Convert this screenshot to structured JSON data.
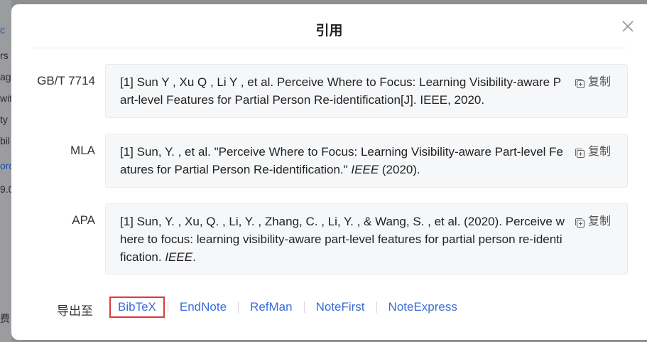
{
  "background_fragments": [
    "c",
    "rs",
    "ag",
    "wit",
    "ty",
    "bil",
    "ord",
    "9.0",
    "费"
  ],
  "dialog": {
    "title": "引用",
    "copy_label": "复制",
    "citations": [
      {
        "format": "GB/T 7714",
        "text": "[1] Sun Y , Xu Q , Li Y , et al. Perceive Where to Focus: Learning Visibility-aware Part-level Features for Partial Person Re-identification[J]. IEEE, 2020."
      },
      {
        "format": "MLA",
        "text_before": "[1] Sun, Y. , et al. \"Perceive Where to Focus: Learning Visibility-aware Part-level Features for Partial Person Re-identification.\" ",
        "journal": "IEEE",
        "text_after": " (2020)."
      },
      {
        "format": "APA",
        "text_before": "[1] Sun, Y. , Xu, Q. , Li, Y. , Zhang, C. , Li, Y. , & Wang, S. , et al. (2020). Perceive where to focus: learning visibility-aware part-level features for partial person re-identification. ",
        "journal": "IEEE",
        "text_after": "."
      }
    ],
    "export": {
      "label": "导出至",
      "options": [
        "BibTeX",
        "EndNote",
        "RefMan",
        "NoteFirst",
        "NoteExpress"
      ],
      "selected": "BibTeX"
    }
  },
  "colors": {
    "link": "#3a6ed8",
    "highlight_border": "#e0383b",
    "box_background": "#f6f7f9"
  }
}
